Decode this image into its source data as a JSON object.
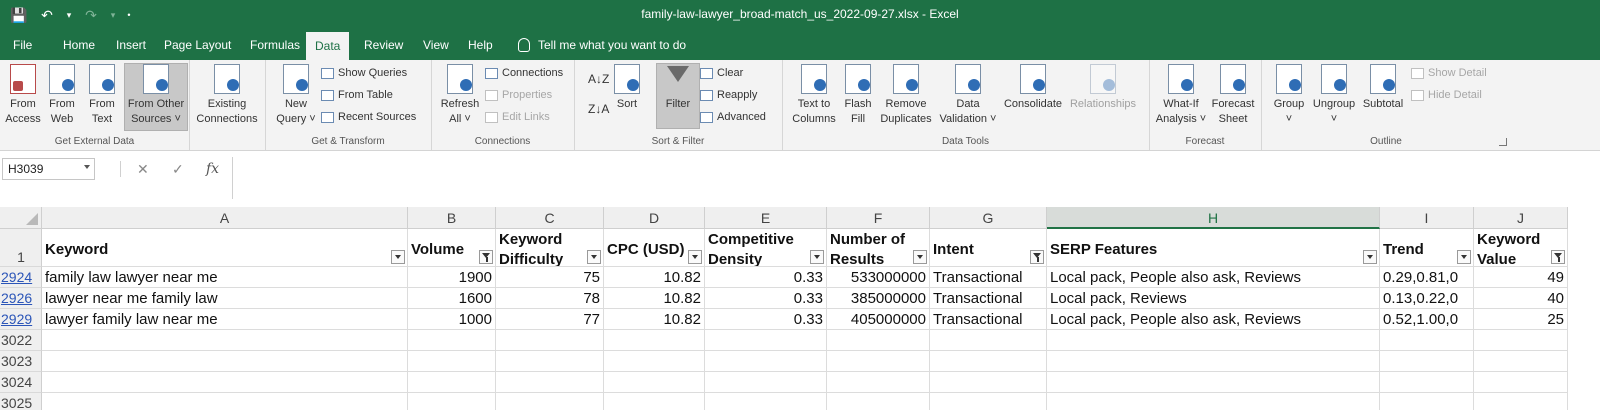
{
  "window": {
    "title": "family-law-lawyer_broad-match_us_2022-09-27.xlsx  -  Excel"
  },
  "qat": {
    "save_icon": "save-icon",
    "undo_icon": "undo-icon",
    "redo_icon": "redo-icon"
  },
  "tabs": [
    "File",
    "Home",
    "Insert",
    "Page Layout",
    "Formulas",
    "Data",
    "Review",
    "View",
    "Help"
  ],
  "active_tab": "Data",
  "tell_me": "Tell me what you want to do",
  "ribbon": {
    "get_external": {
      "label": "Get External Data",
      "from_access": "From\nAccess",
      "from_web": "From\nWeb",
      "from_text": "From\nText",
      "from_other": "From Other\nSources ˅"
    },
    "existing": "Existing\nConnections",
    "get_transform": {
      "label": "Get & Transform",
      "new_query": "New\nQuery ˅",
      "show_queries": "Show Queries",
      "from_table": "From Table",
      "recent_sources": "Recent Sources"
    },
    "connections": {
      "label": "Connections",
      "refresh_all": "Refresh\nAll ˅",
      "connections": "Connections",
      "properties": "Properties",
      "edit_links": "Edit Links"
    },
    "sort_filter": {
      "label": "Sort & Filter",
      "sort": "Sort",
      "filter": "Filter",
      "clear": "Clear",
      "reapply": "Reapply",
      "advanced": "Advanced"
    },
    "data_tools": {
      "label": "Data Tools",
      "text_to_columns": "Text to\nColumns",
      "flash_fill": "Flash\nFill",
      "remove_duplicates": "Remove\nDuplicates",
      "data_validation": "Data\nValidation ˅",
      "consolidate": "Consolidate",
      "relationships": "Relationships"
    },
    "forecast": {
      "label": "Forecast",
      "what_if": "What-If\nAnalysis ˅",
      "forecast_sheet": "Forecast\nSheet"
    },
    "outline": {
      "label": "Outline",
      "group": "Group\n˅",
      "ungroup": "Ungroup\n˅",
      "subtotal": "Subtotal",
      "show_detail": "Show Detail",
      "hide_detail": "Hide Detail"
    }
  },
  "formula_bar": {
    "name_box": "H3039",
    "cancel": "✕",
    "enter": "✓",
    "fx": "fx",
    "value": ""
  },
  "grid": {
    "columns": [
      "A",
      "B",
      "C",
      "D",
      "E",
      "F",
      "G",
      "H",
      "I",
      "J"
    ],
    "selected_column": "H",
    "header_row_number": "1",
    "headers": [
      "Keyword",
      "Volume",
      "Keyword\nDifficulty",
      "CPC (USD)",
      "Competitive\nDensity",
      "Number of\nResults",
      "Intent",
      "SERP Features",
      "Trend",
      "Keyword\nValue"
    ],
    "filtered_columns": [
      1,
      6,
      9
    ],
    "rows": [
      {
        "num": "2924",
        "cells": [
          "family law lawyer near me",
          "1900",
          "75",
          "10.82",
          "0.33",
          "533000000",
          "Transactional",
          "Local pack, People also ask, Reviews",
          "0.29,0.81,0",
          "49"
        ]
      },
      {
        "num": "2926",
        "cells": [
          "lawyer near me family law",
          "1600",
          "78",
          "10.82",
          "0.33",
          "385000000",
          "Transactional",
          "Local pack, Reviews",
          "0.13,0.22,0",
          "40"
        ]
      },
      {
        "num": "2929",
        "cells": [
          "lawyer family law near me",
          "1000",
          "77",
          "10.82",
          "0.33",
          "405000000",
          "Transactional",
          "Local pack, People also ask, Reviews",
          "0.52,1.00,0",
          "25"
        ]
      }
    ],
    "empty_rows": [
      "3022",
      "3023",
      "3024",
      "3025"
    ]
  }
}
